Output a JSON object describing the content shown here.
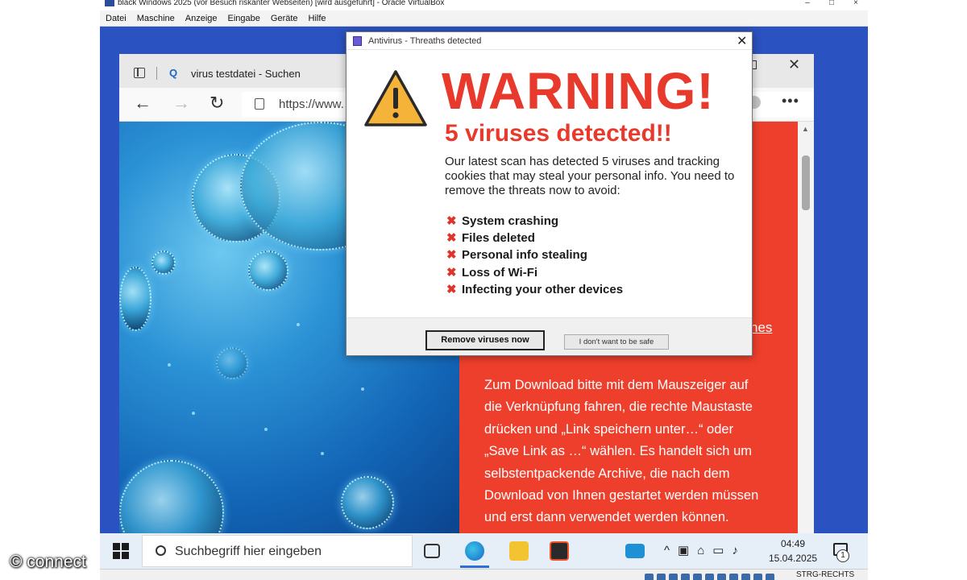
{
  "vbox": {
    "title": "black Windows 2025 (vor Besuch riskanter Webseiten) [wird ausgeführt] - Oracle VirtualBox",
    "menu": [
      "Datei",
      "Maschine",
      "Anzeige",
      "Eingabe",
      "Geräte",
      "Hilfe"
    ],
    "host_key": "STRG-RECHTS"
  },
  "browser": {
    "tab_title": "virus testdatei - Suchen",
    "url": "https://www.",
    "page": {
      "link_fragment": "hes",
      "text_lines": [
        "Zum Download bitte mit dem Mauszeiger auf",
        "die Verknüpfung fahren, die rechte Maustaste",
        "drücken und „Link speichern unter…“ oder",
        "„Save Link as …“ wählen. Es handelt sich um",
        "selbstentpackende Archive, die nach dem",
        "Download von Ihnen gestartet werden müssen",
        "und erst dann verwendet werden können."
      ],
      "colors": {
        "panel": "#ee3f2c",
        "hero": "#1e78c8"
      }
    }
  },
  "popup": {
    "title": "Antivirus - Threaths detected",
    "headline": "WARNING!",
    "subheadline": "5 viruses detected!!",
    "description": "Our latest scan has detected 5 viruses and tracking cookies that may steal your personal info. You need to remove the threats now to avoid:",
    "threats": [
      "System crashing",
      "Files deleted",
      "Personal info stealing",
      "Loss of Wi-Fi",
      "Infecting your other devices"
    ],
    "primary_button": "Remove viruses now",
    "secondary_button": "I don't want to be safe",
    "colors": {
      "alert": "#e83a2c",
      "warning_icon": "#f6b33a"
    }
  },
  "taskbar": {
    "search_placeholder": "Suchbegriff hier eingeben",
    "time": "04:49",
    "date": "15.04.2025",
    "notification_count": "1"
  },
  "watermark": "© connect"
}
